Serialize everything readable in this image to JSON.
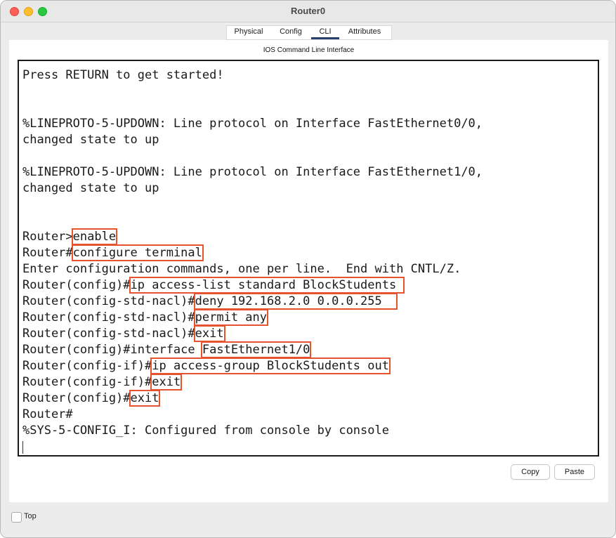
{
  "window": {
    "title": "Router0"
  },
  "tabs": [
    {
      "label": "Physical"
    },
    {
      "label": "Config"
    },
    {
      "label": "CLI"
    },
    {
      "label": "Attributes"
    }
  ],
  "panel": {
    "title": "IOS Command Line Interface"
  },
  "console": {
    "lines": [
      {
        "prefix": "Press RETURN to get started!",
        "cmd": ""
      },
      {
        "prefix": "%LINEPROTO-5-UPDOWN: Line protocol on Interface FastEthernet0/0,",
        "cmd": ""
      },
      {
        "prefix": "changed state to up",
        "cmd": ""
      },
      {
        "prefix": "%LINEPROTO-5-UPDOWN: Line protocol on Interface FastEthernet1/0,",
        "cmd": ""
      },
      {
        "prefix": "changed state to up",
        "cmd": ""
      },
      {
        "prefix": "Router>",
        "cmd": "enable"
      },
      {
        "prefix": "Router#",
        "cmd": "configure terminal"
      },
      {
        "prefix": "Enter configuration commands, one per line.  End with CNTL/Z.",
        "cmd": ""
      },
      {
        "prefix": "Router(config)#",
        "cmd": "ip access-list standard BlockStudents "
      },
      {
        "prefix": "Router(config-std-nacl)#",
        "cmd": "deny 192.168.2.0 0.0.0.255  "
      },
      {
        "prefix": "Router(config-std-nacl)#",
        "cmd": "permit any"
      },
      {
        "prefix": "Router(config-std-nacl)#",
        "cmd": "exit"
      },
      {
        "prefix": "Router(config)#interface ",
        "cmd": "FastEthernet1/0"
      },
      {
        "prefix": "Router(config-if)#",
        "cmd": "ip access-group BlockStudents out"
      },
      {
        "prefix": "Router(config-if)#",
        "cmd": "exit"
      },
      {
        "prefix": "Router(config)#",
        "cmd": "exit"
      },
      {
        "prefix": "Router#",
        "cmd": ""
      },
      {
        "prefix": "%SYS-5-CONFIG_I: Configured from console by console",
        "cmd": ""
      }
    ]
  },
  "buttons": {
    "copy": "Copy",
    "paste": "Paste"
  },
  "options": {
    "top_label": "Top",
    "top_checked": false
  },
  "colors": {
    "highlight": "#e8532f",
    "active_tab": "#2a3e6b"
  }
}
